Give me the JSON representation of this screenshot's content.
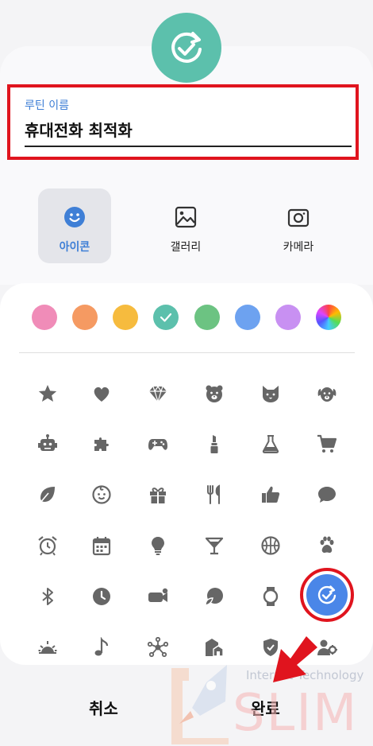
{
  "routine": {
    "icon": "refresh-check-icon",
    "icon_color": "#5cc0ac",
    "name_label": "루틴 이름",
    "name_value": "휴대전화 최적화"
  },
  "type_tabs": [
    {
      "label": "아이콘",
      "icon": "smiley-icon",
      "selected": true
    },
    {
      "label": "갤러리",
      "icon": "image-icon",
      "selected": false
    },
    {
      "label": "카메라",
      "icon": "camera-icon",
      "selected": false
    }
  ],
  "colors": [
    {
      "name": "pink",
      "hex": "#f08cb8"
    },
    {
      "name": "orange",
      "hex": "#f59a62"
    },
    {
      "name": "yellow",
      "hex": "#f6bb3e"
    },
    {
      "name": "teal",
      "hex": "#5cc0ac",
      "selected": true
    },
    {
      "name": "green",
      "hex": "#6cc382"
    },
    {
      "name": "blue",
      "hex": "#6da2f0"
    },
    {
      "name": "purple",
      "hex": "#c890f2"
    },
    {
      "name": "rainbow",
      "hex": "gradient"
    }
  ],
  "icons": [
    [
      "star-icon",
      "heart-icon",
      "diamond-icon",
      "bear-icon",
      "cat-icon",
      "dog-icon"
    ],
    [
      "robot-icon",
      "puzzle-icon",
      "gamepad-icon",
      "lipstick-icon",
      "flask-icon",
      "cart-icon"
    ],
    [
      "leaf-icon",
      "baby-icon",
      "gift-icon",
      "fork-knife-icon",
      "thumbs-up-icon",
      "chat-bubble-icon"
    ],
    [
      "alarm-clock-icon",
      "calendar-icon",
      "lightbulb-icon",
      "cocktail-icon",
      "basketball-icon",
      "paw-icon"
    ],
    [
      "bluetooth-icon",
      "clock-icon",
      "video-camera-icon",
      "moon-leaf-icon",
      "watch-icon",
      "refresh-check-icon"
    ],
    [
      "sunrise-icon",
      "music-note-icon",
      "network-icon",
      "home-icon",
      "shield-icon",
      "person-gear-icon"
    ]
  ],
  "selected_icon": "refresh-check-icon",
  "buttons": {
    "cancel": "취소",
    "done": "완료"
  },
  "watermark": {
    "sub": "Internet Technology",
    "brand": "SLIM"
  }
}
